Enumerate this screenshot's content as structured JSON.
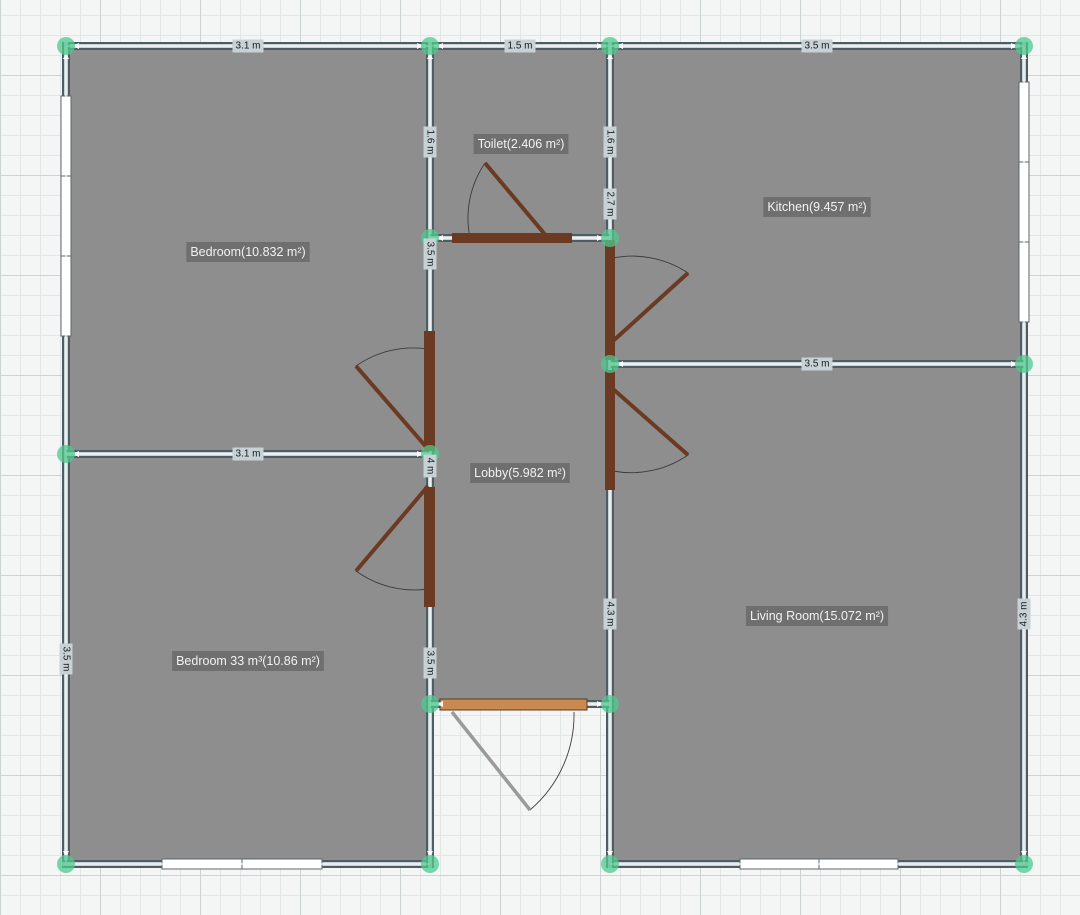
{
  "colors": {
    "floor": "#8e8e8e",
    "wall_fill": "#c7d2d6",
    "wall_edge": "#4f5c63",
    "node": "#4fc98e",
    "door": "#6b3a22",
    "entrance_door": "#c98a52",
    "label_bg": "#6a6a6a"
  },
  "rooms": [
    {
      "id": "bedroom-1",
      "label": "Bedroom(10.832 m²)"
    },
    {
      "id": "toilet",
      "label": "Toilet(2.406 m²)"
    },
    {
      "id": "kitchen",
      "label": "Kitchen(9.457 m²)"
    },
    {
      "id": "lobby",
      "label": "Lobby(5.982 m²)"
    },
    {
      "id": "bedroom-2",
      "label": "Bedroom 33 m³(10.86 m²)"
    },
    {
      "id": "living-room",
      "label": "Living Room(15.072 m²)"
    }
  ],
  "dimensions": [
    {
      "id": "top-left",
      "text": "3.1 m"
    },
    {
      "id": "top-middle",
      "text": "1.5 m"
    },
    {
      "id": "top-right",
      "text": "3.5 m"
    },
    {
      "id": "kitchen-living",
      "text": "3.5 m"
    },
    {
      "id": "bedrooms-divider",
      "text": "3.1 m"
    },
    {
      "id": "toilet-left",
      "text": "1.6 m"
    },
    {
      "id": "toilet-right",
      "text": "1.6 m"
    },
    {
      "id": "kitchen-lower",
      "text": "2.7 m"
    },
    {
      "id": "lobby-upper-left",
      "text": "3.5 m"
    },
    {
      "id": "lobby-mid-left",
      "text": "4 m"
    },
    {
      "id": "lobby-lower-left",
      "text": "3.5 m"
    },
    {
      "id": "lobby-right",
      "text": "4.3 m"
    },
    {
      "id": "living-right",
      "text": "4.3 m"
    },
    {
      "id": "bedroom-left",
      "text": "3.5 m"
    }
  ]
}
